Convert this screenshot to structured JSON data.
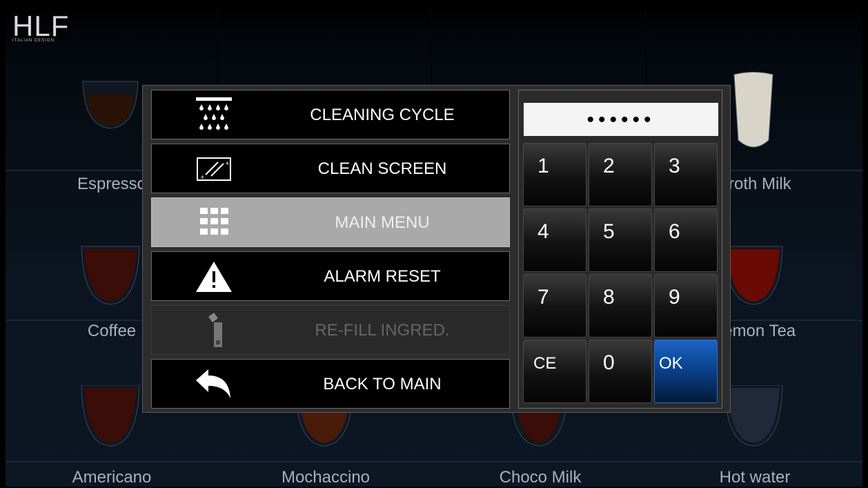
{
  "brand": {
    "logo": "HLF",
    "tagline": "ITALIAN DESIGN"
  },
  "drinks": [
    {
      "name": "Espresso",
      "fill": "#2a1306"
    },
    {
      "name": "Froth Milk",
      "fill": "#d8d5c8"
    },
    {
      "name": "Coffee",
      "fill": "#3a0d08"
    },
    {
      "name": "Lemon Tea",
      "fill": "#6a0a04"
    },
    {
      "name": "Americano",
      "fill": "#3a0d08"
    },
    {
      "name": "Mochaccino",
      "fill": "#4a1a0a"
    },
    {
      "name": "Choco Milk",
      "fill": "#3a0d08"
    },
    {
      "name": "Hot water",
      "fill": "#20283a"
    }
  ],
  "menu": {
    "items": [
      {
        "label": "CLEANING CYCLE",
        "icon": "cleaning-cycle-icon",
        "state": "normal"
      },
      {
        "label": "CLEAN SCREEN",
        "icon": "clean-screen-icon",
        "state": "normal"
      },
      {
        "label": "MAIN MENU",
        "icon": "grid-icon",
        "state": "selected"
      },
      {
        "label": "ALARM RESET",
        "icon": "warning-icon",
        "state": "normal"
      },
      {
        "label": "RE-FILL INGRED.",
        "icon": "refill-icon",
        "state": "disabled"
      },
      {
        "label": "BACK TO MAIN",
        "icon": "back-arrow-icon",
        "state": "normal"
      }
    ]
  },
  "keypad": {
    "pin_display": "••••••",
    "keys": [
      "1",
      "2",
      "3",
      "4",
      "5",
      "6",
      "7",
      "8",
      "9",
      "CE",
      "0",
      "OK"
    ]
  },
  "colors": {
    "ok_key": "#0a3f86",
    "selected_item": "#a9a9a9"
  }
}
